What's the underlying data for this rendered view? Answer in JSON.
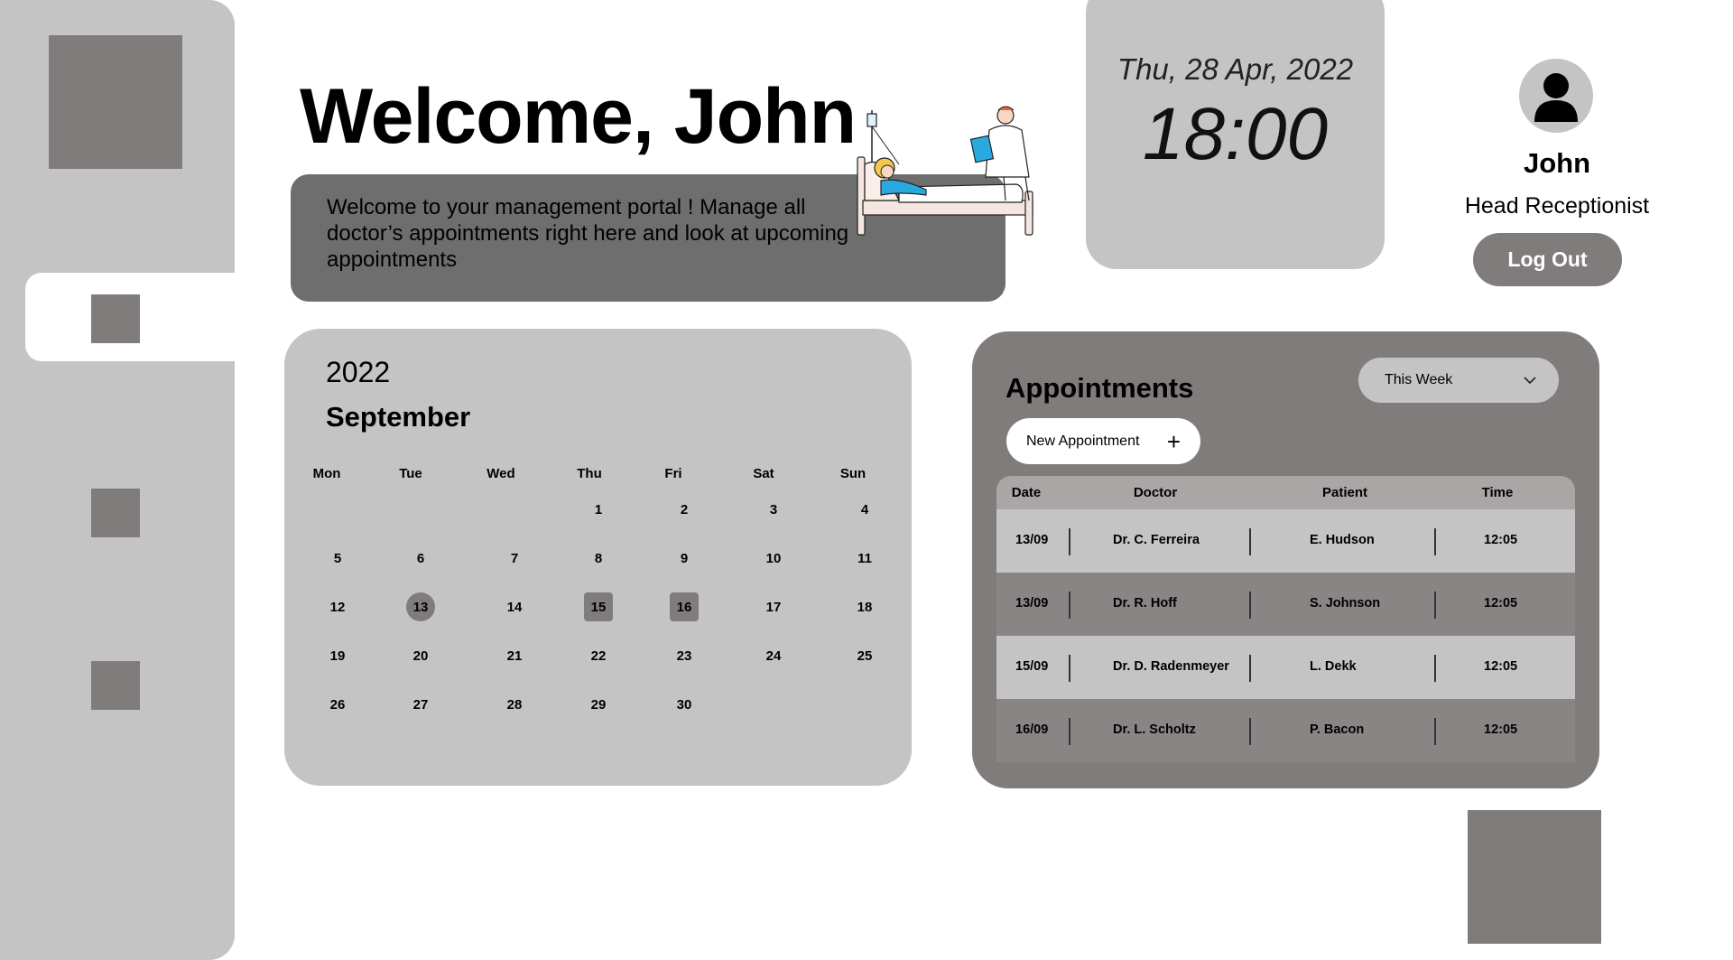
{
  "header": {
    "welcome_title": "Welcome, John",
    "welcome_message": "Welcome to your management portal ! Manage all doctor’s appointments right here and look at upcoming appointments"
  },
  "datetime": {
    "date": "Thu, 28 Apr, 2022",
    "time": "18:00"
  },
  "profile": {
    "name": "John",
    "role": "Head Receptionist",
    "logout_label": "Log Out"
  },
  "calendar": {
    "year": "2022",
    "month": "September",
    "day_names": [
      "Mon",
      "Tue",
      "Wed",
      "Thu",
      "Fri",
      "Sat",
      "Sun"
    ],
    "weeks": [
      [
        "",
        "",
        "",
        "1",
        "2",
        "3",
        "4"
      ],
      [
        "5",
        "6",
        "7",
        "8",
        "9",
        "10",
        "11"
      ],
      [
        "12",
        "13",
        "14",
        "15",
        "16",
        "17",
        "18"
      ],
      [
        "19",
        "20",
        "21",
        "22",
        "23",
        "24",
        "25"
      ],
      [
        "26",
        "27",
        "28",
        "29",
        "30",
        "",
        ""
      ]
    ],
    "selected_date": "13",
    "highlighted_dates": [
      "15",
      "16"
    ]
  },
  "appointments": {
    "title": "Appointments",
    "filter_value": "This Week",
    "new_button_label": "New Appointment",
    "columns": [
      "Date",
      "Doctor",
      "Patient",
      "Time"
    ],
    "rows": [
      {
        "date": "13/09",
        "doctor": "Dr. C. Ferreira",
        "patient": "E. Hudson",
        "time": "12:05"
      },
      {
        "date": "13/09",
        "doctor": "Dr. R. Hoff",
        "patient": "S. Johnson",
        "time": "12:05"
      },
      {
        "date": "15/09",
        "doctor": "Dr. D. Radenmeyer",
        "patient": "L. Dekk",
        "time": "12:05"
      },
      {
        "date": "16/09",
        "doctor": "Dr. L. Scholtz",
        "patient": "P. Bacon",
        "time": "12:05"
      }
    ]
  },
  "colors": {
    "sidebar": "#c4c4c4",
    "accent_gray": "#807c7b",
    "welcome_box": "#6e6e6e"
  }
}
